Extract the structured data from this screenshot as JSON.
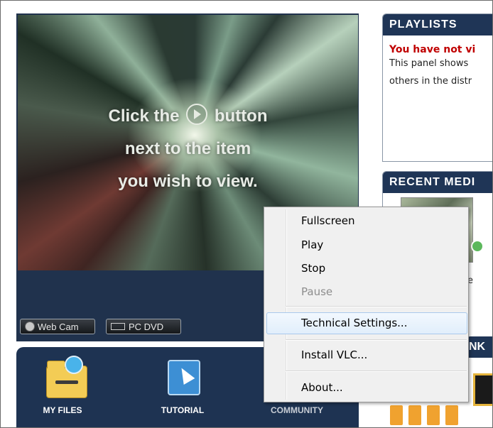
{
  "video": {
    "line1_before": "Click the",
    "line1_after": "button",
    "line2": "next to the item",
    "line3": "you wish to view.",
    "sources": [
      "Web Cam",
      "PC DVD"
    ]
  },
  "nav": {
    "items": [
      {
        "label": "MY FILES",
        "icon": "folder-disc-icon"
      },
      {
        "label": "TUTORIAL",
        "icon": "cursor-icon"
      },
      {
        "label": "COMMUNITY",
        "icon": "community-icon"
      }
    ]
  },
  "panels": {
    "playlists": {
      "title": "PLAYLISTS",
      "warning": "You have not vi",
      "text_lines": [
        "This panel shows",
        "others in the distr"
      ]
    },
    "recent": {
      "title": "RECENT MEDI",
      "fragment": "e"
    },
    "links": {
      "title": "NK"
    }
  },
  "context_menu": {
    "items": [
      {
        "label": "Fullscreen",
        "enabled": true
      },
      {
        "label": "Play",
        "enabled": true
      },
      {
        "label": "Stop",
        "enabled": true
      },
      {
        "label": "Pause",
        "enabled": false
      },
      {
        "label": "Technical Settings...",
        "enabled": true,
        "highlighted": true
      },
      {
        "label": "Install VLC...",
        "enabled": true
      },
      {
        "label": "About...",
        "enabled": true
      }
    ]
  },
  "colors": {
    "nav_bg": "#1e3352",
    "panel_header": "#1f3556",
    "warning_red": "#c00000",
    "menu_bg": "#f0f0f0",
    "menu_highlight_border": "#a9c9ec"
  }
}
